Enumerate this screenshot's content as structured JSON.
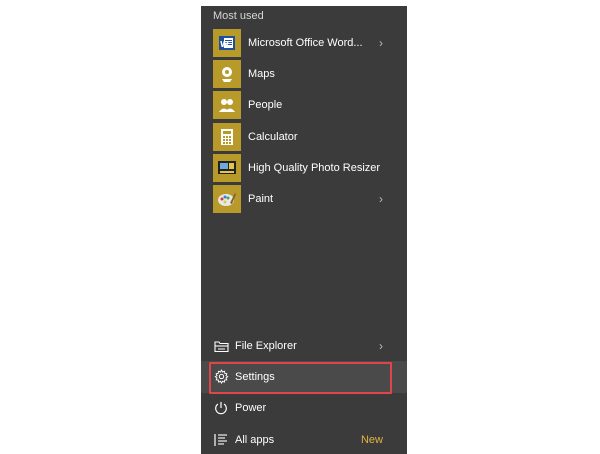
{
  "section_label": "Most used",
  "apps": [
    {
      "label": "Microsoft Office Word...",
      "icon": "word-icon",
      "has_submenu": true
    },
    {
      "label": "Maps",
      "icon": "maps-icon",
      "has_submenu": false
    },
    {
      "label": "People",
      "icon": "people-icon",
      "has_submenu": false
    },
    {
      "label": "Calculator",
      "icon": "calculator-icon",
      "has_submenu": false
    },
    {
      "label": "High Quality Photo Resizer",
      "icon": "photo-resizer-icon",
      "has_submenu": false
    },
    {
      "label": "Paint",
      "icon": "paint-icon",
      "has_submenu": true
    }
  ],
  "bottom": {
    "file_explorer": {
      "label": "File Explorer",
      "icon": "folder-icon"
    },
    "settings": {
      "label": "Settings",
      "icon": "gear-icon"
    },
    "power": {
      "label": "Power",
      "icon": "power-icon"
    },
    "all_apps": {
      "label": "All apps",
      "icon": "list-icon",
      "badge": "New"
    }
  },
  "chevron_glyph": "›",
  "colors": {
    "menu_bg": "#3b3b3b",
    "tile_bg": "#b89a2a",
    "highlight": "#e0454a",
    "new_badge": "#e3b341"
  }
}
